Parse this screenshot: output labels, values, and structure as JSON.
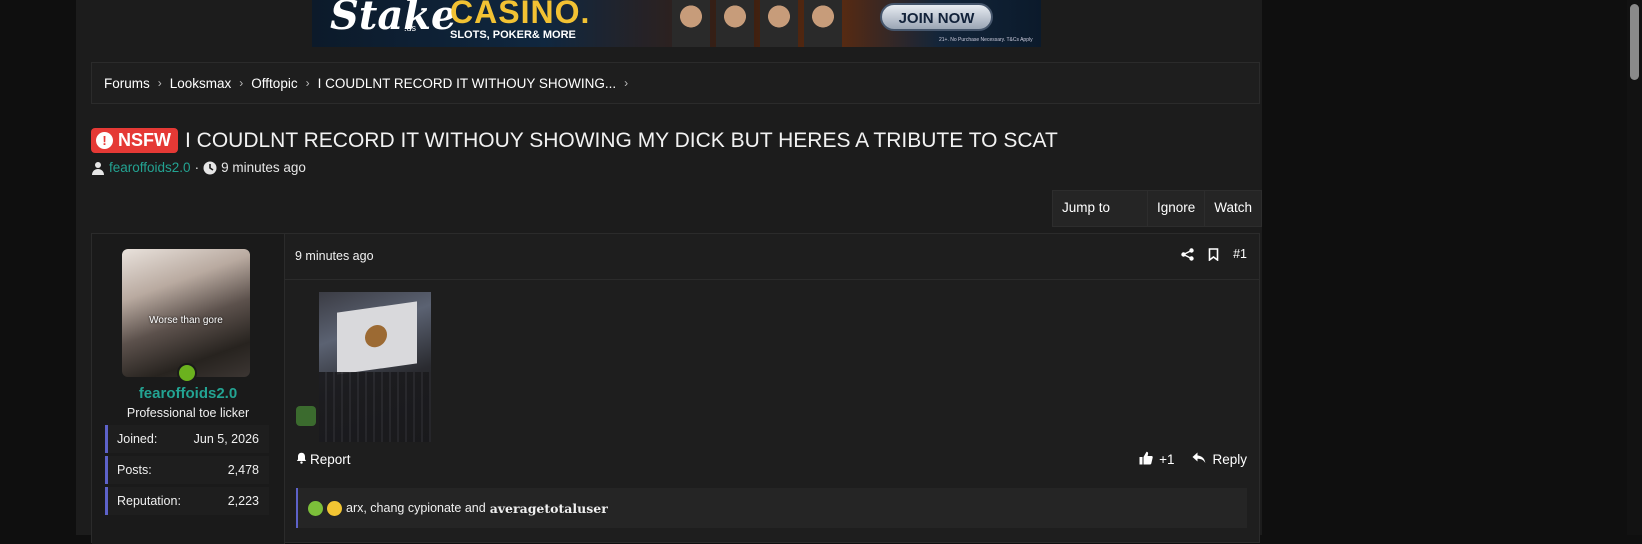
{
  "banner": {
    "brand": "Stake",
    "brand_suffix": ".us",
    "headline": "CASINO.",
    "tagline": "SLOTS, POKER& MORE",
    "cta": "JOIN NOW",
    "fine_print": "21+. No Purchase Necessary. T&Cs Apply"
  },
  "breadcrumb": [
    "Forums",
    "Looksmax",
    "Offtopic",
    "I COUDLNT RECORD IT WITHOUY SHOWING..."
  ],
  "thread": {
    "prefix": "NSFW",
    "title": "I COUDLNT RECORD IT WITHOUY SHOWING MY DICK BUT HERES A TRIBUTE TO SCAT",
    "author": "fearoffoids2.0",
    "separator": "·",
    "time": "9 minutes ago"
  },
  "thread_actions": {
    "jump": "Jump to new",
    "ignore": "Ignore",
    "watch": "Watch"
  },
  "post": {
    "user": {
      "avatar_caption": "Worse than gore",
      "name": "fearoffoids2.0",
      "title": "Professional toe licker",
      "stats": [
        {
          "label": "Joined:",
          "value": "Jun 5, 2026"
        },
        {
          "label": "Posts:",
          "value": "2,478"
        },
        {
          "label": "Reputation:",
          "value": "2,223"
        }
      ]
    },
    "time": "9 minutes ago",
    "number": "#1",
    "report": "Report",
    "react_count": "+1",
    "reply": "Reply",
    "reactions_text": "arx, chang cypionate and",
    "reactions_bold": "averagetotaluser"
  },
  "colors": {
    "accent": "#23a392",
    "nsfw": "#e53935",
    "stat_border": "#5d62c9",
    "online": "#6bb21e"
  },
  "icons": [
    "user-icon",
    "clock-icon",
    "share-icon",
    "bookmark-icon",
    "bell-icon",
    "thumbs-up-icon",
    "reply-icon",
    "exclamation-icon",
    "chevron-right-icon"
  ]
}
